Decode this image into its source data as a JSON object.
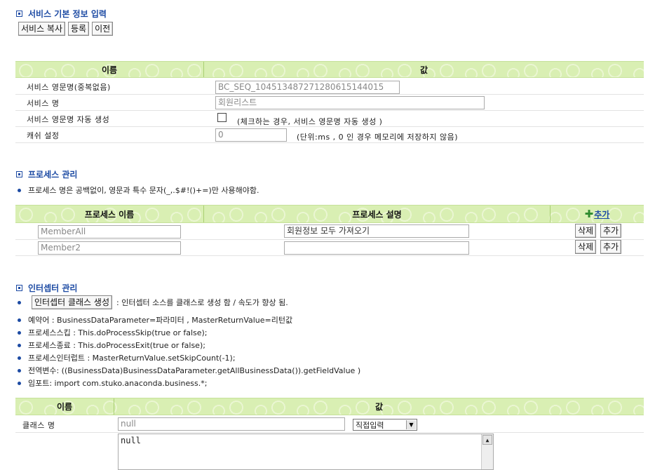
{
  "section1": {
    "title": "서비스 기본 정보 입력",
    "buttons": {
      "copy": "서비스 복사",
      "register": "등록",
      "prev": "이전"
    },
    "table": {
      "col_name": "이름",
      "col_value": "값",
      "rows": {
        "eng_name_label": "서비스 영문명(중복없음)",
        "eng_name_value": "BC_SEQ_10451348727128061514401​5",
        "name_label": "서비스 명",
        "name_value": "회원리스트",
        "auto_label": "서비스 영문명 자동 생성",
        "auto_note": "(체크하는 경우, 서비스 영문명 자동 생성 )",
        "cache_label": "캐쉬 설정",
        "cache_value": "0",
        "cache_note": "(단위:ms , 0 인 경우 메모리에 저장하지 않음)"
      }
    }
  },
  "section2": {
    "title": "프로세스 관리",
    "note": "프로세스 명은 공백없이, 영문과 특수 문자(_,.$#!()+=)만 사용해야함.",
    "table": {
      "col_name": "프로세스 이름",
      "col_desc": "프로세스 설명",
      "add_link": "추가",
      "rows": [
        {
          "name": "MemberAll",
          "desc": "회원정보 모두 가져오기",
          "delete": "삭제",
          "add": "추가"
        },
        {
          "name": "Member2",
          "desc": "",
          "delete": "삭제",
          "add": "추가"
        }
      ]
    }
  },
  "section3": {
    "title": "인터셉터 관리",
    "gen_button": "인터셉터 클래스 생성",
    "gen_note": ": 인터셉터 소스를 클래스로 생성 함 / 속도가 향상 됨.",
    "bullets": [
      "예약어 : BusinessDataParameter=파라미터 , MasterReturnValue=리턴값",
      "프로세스스킵 : This.doProcessSkip(true or false);",
      "프로세스종료 : This.doProcessExit(true or false);",
      "프로세스인터럽트 : MasterReturnValue.setSkipCount(-1);",
      "전역변수: ((BusinessData)BusinessDataParameter.getAllBusinessData()).getFieldValue )",
      "임포트: import com.stuko.anaconda.business.*;"
    ],
    "table": {
      "col_name": "이름",
      "col_value": "값",
      "class_label": "클래스 명",
      "class_placeholder": "null",
      "select_value": "직접입력",
      "textarea_value": "null"
    }
  },
  "colors": {
    "header_bg": "#d9efb3",
    "title_blue": "#1c4aa3"
  },
  "icons": [
    "section-square-icon",
    "bullet-icon",
    "plus-icon",
    "select-arrow-icon",
    "scroll-up-icon"
  ]
}
